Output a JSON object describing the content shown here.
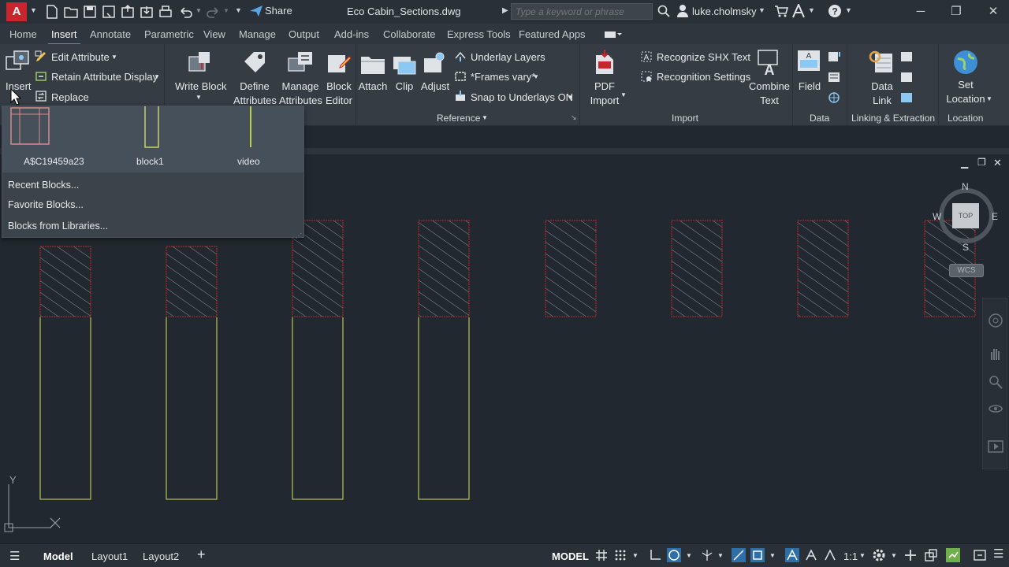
{
  "app": {
    "logo_letter": "A",
    "document_title": "Eco Cabin_Sections.dwg"
  },
  "quick_access": {
    "share_label": "Share"
  },
  "search": {
    "placeholder": "Type a keyword or phrase"
  },
  "user": {
    "name": "luke.cholmsky"
  },
  "tabs": [
    {
      "label": "Home"
    },
    {
      "label": "Insert"
    },
    {
      "label": "Annotate"
    },
    {
      "label": "Parametric"
    },
    {
      "label": "View"
    },
    {
      "label": "Manage"
    },
    {
      "label": "Output"
    },
    {
      "label": "Add-ins"
    },
    {
      "label": "Collaborate"
    },
    {
      "label": "Express Tools"
    },
    {
      "label": "Featured Apps"
    }
  ],
  "ribbon": {
    "insert": "Insert",
    "edit_attribute": "Edit Attribute",
    "retain_attribute_display": "Retain Attribute Display",
    "replace": "Replace",
    "write_block": "Write Block",
    "define": "Define",
    "attributes": "Attributes",
    "manage": "Manage",
    "block": "Block",
    "editor": "Editor",
    "attach": "Attach",
    "clip": "Clip",
    "adjust": "Adjust",
    "underlay_layers": "Underlay Layers",
    "frames_vary": "*Frames vary*",
    "snap_to_underlays": "Snap to Underlays ON",
    "pdf": "PDF",
    "import": "Import",
    "recognize_shx": "Recognize SHX Text",
    "recognition_settings": "Recognition Settings",
    "combine": "Combine",
    "text": "Text",
    "field": "Field",
    "data": "Data",
    "link": "Link",
    "set": "Set",
    "location": "Location",
    "panels": {
      "reference": "Reference",
      "import": "Import",
      "data": "Data",
      "linking": "Linking & Extraction",
      "location": "Location"
    }
  },
  "gallery": {
    "blocks": [
      {
        "name": "A$C19459a23"
      },
      {
        "name": "block1"
      },
      {
        "name": "video"
      }
    ],
    "menu": [
      {
        "label": "Recent Blocks..."
      },
      {
        "label": "Favorite Blocks..."
      },
      {
        "label": "Blocks from Libraries..."
      }
    ]
  },
  "viewcube": {
    "n": "N",
    "s": "S",
    "e": "E",
    "w": "W",
    "top": "TOP",
    "wcs": "WCS"
  },
  "ucs": {
    "y": "Y"
  },
  "status": {
    "tabs": [
      {
        "label": "Model"
      },
      {
        "label": "Layout1"
      },
      {
        "label": "Layout2"
      }
    ],
    "model_button": "MODEL",
    "scale": "1:1"
  },
  "colors": {
    "accent": "#3b92d6",
    "hatch_red": "#c0282d",
    "outline_yellow": "#d8e05a"
  }
}
